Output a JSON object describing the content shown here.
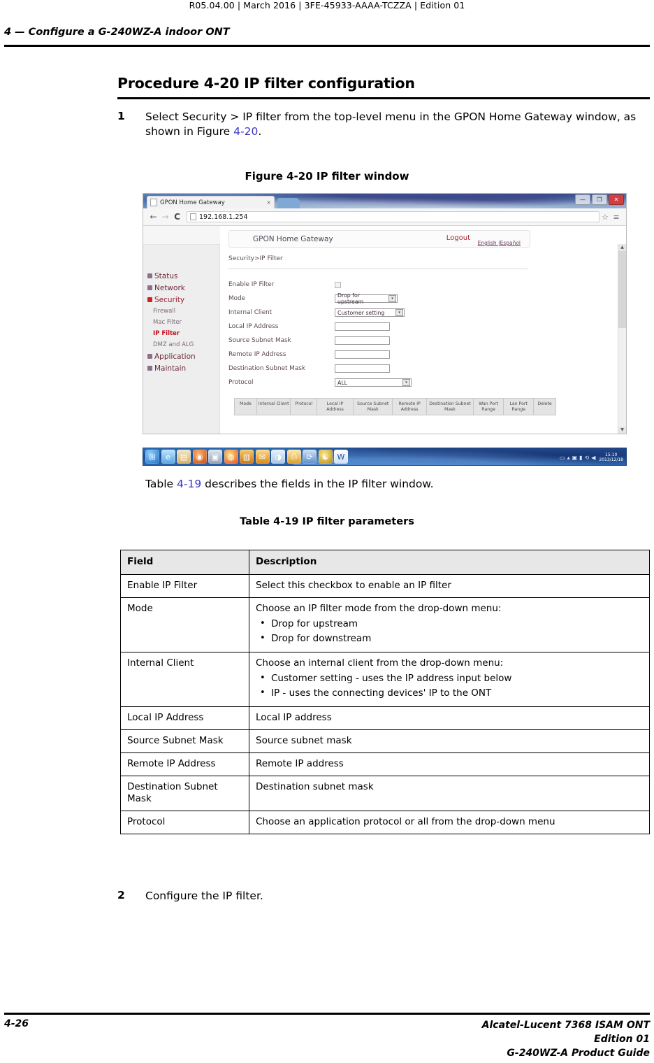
{
  "header": {
    "running_head": "R05.04.00 | March 2016 | 3FE-45933-AAAA-TCZZA | Edition 01",
    "chapter": "4 —  Configure a G-240WZ-A indoor ONT"
  },
  "procedure": {
    "title": "Procedure 4-20  IP filter configuration",
    "steps": [
      {
        "number": "1",
        "text_before": "Select Security > IP filter from the top-level menu in the GPON Home Gateway window, as shown in Figure ",
        "xref": "4-20",
        "text_after": "."
      },
      {
        "number": "2",
        "text": "Configure the IP filter."
      }
    ]
  },
  "figure": {
    "caption": "Figure 4-20  IP filter window",
    "browser": {
      "tab_title": "GPON Home Gateway",
      "tab_close": "×",
      "back_icon": "←",
      "forward_icon": "→",
      "reload_icon": "C",
      "url": "192.168.1.254",
      "bookmark_icon": "☆",
      "menu_icon": "≡",
      "minimize_icon": "—",
      "maximize_icon": "❐",
      "close_icon": "✕"
    },
    "webui": {
      "app_title": "GPON Home Gateway",
      "logout": "Logout",
      "language": "English |Español",
      "breadcrumb": "Security>IP Filter",
      "sidebar": [
        {
          "label": "Status",
          "type": "top"
        },
        {
          "label": "Network",
          "type": "top"
        },
        {
          "label": "Security",
          "type": "top-expanded"
        },
        {
          "label": "Firewall",
          "type": "sub"
        },
        {
          "label": "Mac Filter",
          "type": "sub"
        },
        {
          "label": "IP Filter",
          "type": "sub-active"
        },
        {
          "label": "DMZ and ALG",
          "type": "sub"
        },
        {
          "label": "Application",
          "type": "top"
        },
        {
          "label": "Maintain",
          "type": "top"
        }
      ],
      "form": [
        {
          "label": "Enable IP Filter",
          "control": "checkbox",
          "value": ""
        },
        {
          "label": "Mode",
          "control": "select",
          "value": "Drop for upstream"
        },
        {
          "label": "Internal Client",
          "control": "select",
          "value": "Customer setting"
        },
        {
          "label": "Local IP Address",
          "control": "text",
          "value": ""
        },
        {
          "label": "Source Subnet Mask",
          "control": "text",
          "value": ""
        },
        {
          "label": "Remote IP Address",
          "control": "text",
          "value": ""
        },
        {
          "label": "Destination Subnet Mask",
          "control": "text",
          "value": ""
        },
        {
          "label": "Protocol",
          "control": "select",
          "value": "ALL"
        }
      ],
      "results_columns": [
        "Mode",
        "Internal Client",
        "Protocol",
        "Local IP Address",
        "Source Subnet Mask",
        "Remote IP Address",
        "Destination Subnet Mask",
        "Wan Port Range",
        "Lan Port Range",
        "Delete"
      ]
    },
    "taskbar": {
      "clock_time": "15:10",
      "clock_date": "2013/12/18"
    }
  },
  "table_intro": {
    "prefix": "Table ",
    "xref": "4-19",
    "suffix": " describes the fields in the IP filter window."
  },
  "table": {
    "caption": "Table 4-19 IP filter parameters",
    "columns": [
      "Field",
      "Description"
    ],
    "rows": [
      {
        "field": "Enable IP Filter",
        "description": "Select this checkbox to enable an IP filter",
        "bullets": []
      },
      {
        "field": "Mode",
        "description": "Choose an IP filter mode from the drop-down menu:",
        "bullets": [
          "Drop for upstream",
          "Drop for downstream"
        ]
      },
      {
        "field": "Internal Client",
        "description": "Choose an internal client from the drop-down menu:",
        "bullets": [
          "Customer setting - uses the IP address input below",
          "IP - uses the connecting devices' IP to the ONT"
        ]
      },
      {
        "field": "Local IP Address",
        "description": "Local IP address",
        "bullets": []
      },
      {
        "field": "Source Subnet Mask",
        "description": "Source subnet mask",
        "bullets": []
      },
      {
        "field": "Remote IP Address",
        "description": "Remote IP address",
        "bullets": []
      },
      {
        "field": "Destination Subnet Mask",
        "description": "Destination subnet mask",
        "bullets": []
      },
      {
        "field": "Protocol",
        "description": "Choose an application protocol or all from the drop-down menu",
        "bullets": []
      }
    ]
  },
  "footer": {
    "page_number": "4-26",
    "line1": "Alcatel-Lucent 7368 ISAM ONT",
    "line2": "Edition 01",
    "line3": "G-240WZ-A Product Guide"
  },
  "colors": {
    "xref_link": "#3a36c8",
    "table_header_bg": "#e7e7e7",
    "active_menu": "#c01020",
    "logout": "#b02a3a"
  }
}
